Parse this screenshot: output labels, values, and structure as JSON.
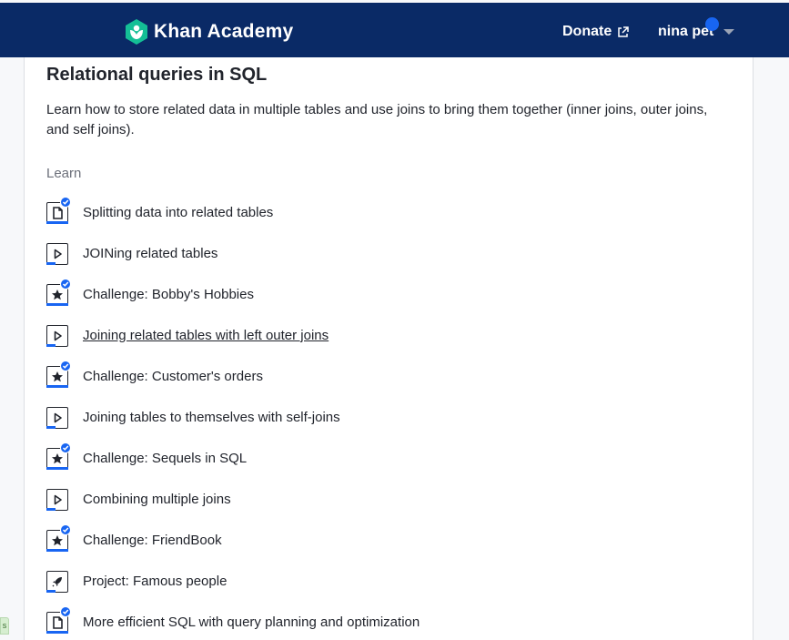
{
  "header": {
    "brand": "Khan Academy",
    "donate_label": "Donate",
    "user_name": "nina pet",
    "background_color": "#0a2a66",
    "accent_color": "#1865f2",
    "logo_icon": "khan-academy-leaf-logo",
    "donate_icon": "external-link-icon",
    "user_icon": "chevron-down-icon"
  },
  "unit": {
    "title": "Relational queries in SQL",
    "description": "Learn how to store related data in multiple tables and use joins to bring them together (inner joins, outer joins, and self joins).",
    "section_label": "Learn",
    "items": [
      {
        "label": "Splitting data into related tables",
        "type": "article",
        "icon": "article-icon",
        "completed": true,
        "progress": 1.0
      },
      {
        "label": "JOINing related tables",
        "type": "video",
        "icon": "play-icon",
        "completed": false,
        "progress": 0.4
      },
      {
        "label": "Challenge: Bobby's Hobbies",
        "type": "challenge",
        "icon": "star-icon",
        "completed": true,
        "progress": 1.0
      },
      {
        "label": "Joining related tables with left outer joins",
        "type": "video",
        "icon": "play-icon",
        "completed": false,
        "progress": 0.4,
        "hovered": true
      },
      {
        "label": "Challenge: Customer's orders",
        "type": "challenge",
        "icon": "star-icon",
        "completed": true,
        "progress": 1.0
      },
      {
        "label": "Joining tables to themselves with self-joins",
        "type": "video",
        "icon": "play-icon",
        "completed": false,
        "progress": 0.4
      },
      {
        "label": "Challenge: Sequels in SQL",
        "type": "challenge",
        "icon": "star-icon",
        "completed": true,
        "progress": 1.0
      },
      {
        "label": "Combining multiple joins",
        "type": "video",
        "icon": "play-icon",
        "completed": false,
        "progress": 0.4
      },
      {
        "label": "Challenge: FriendBook",
        "type": "challenge",
        "icon": "star-icon",
        "completed": true,
        "progress": 1.0
      },
      {
        "label": "Project: Famous people",
        "type": "project",
        "icon": "rocket-icon",
        "completed": false,
        "progress": 0.4
      },
      {
        "label": "More efficient SQL with query planning and optimization",
        "type": "article",
        "icon": "article-icon",
        "completed": true,
        "progress": 1.0
      }
    ]
  }
}
